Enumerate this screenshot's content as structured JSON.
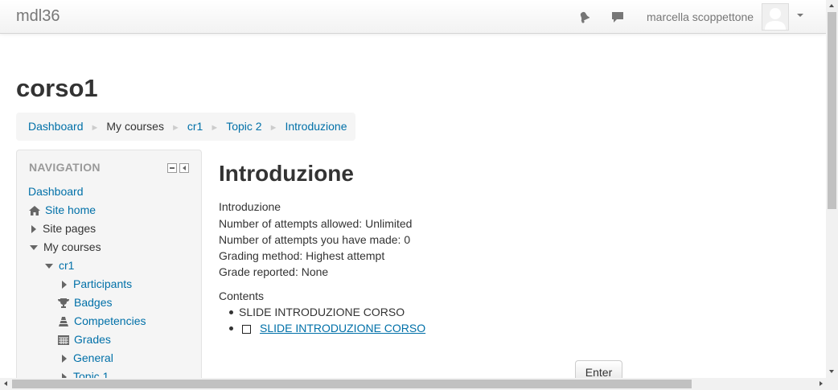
{
  "navbar": {
    "brand": "mdl36",
    "username": "marcella scoppettone"
  },
  "page_title": "corso1",
  "breadcrumb": [
    "Dashboard",
    "My courses",
    "cr1",
    "Topic 2",
    "Introduzione"
  ],
  "navigation": {
    "title": "NAVIGATION",
    "items": [
      "Dashboard",
      "Site home",
      "Site pages",
      "My courses",
      "cr1",
      "Participants",
      "Badges",
      "Competencies",
      "Grades",
      "General",
      "Topic 1"
    ]
  },
  "main": {
    "title": "Introduzione",
    "description": "Introduzione",
    "attempts_allowed": "Number of attempts allowed: Unlimited",
    "attempts_made": "Number of attempts you have made: 0",
    "grading_method": "Grading method: Highest attempt",
    "grade_reported": "Grade reported: None",
    "contents_label": "Contents",
    "contents": [
      "SLIDE INTRODUZIONE CORSO",
      "SLIDE INTRODUZIONE CORSO"
    ],
    "enter_button": "Enter"
  },
  "colors": {
    "link": "#0070a8",
    "text": "#333333",
    "block_bg": "#f5f5f5"
  },
  "icons": [
    "notification-bell-icon",
    "message-icon",
    "avatar-icon",
    "home-icon",
    "trophy-icon",
    "competencies-icon",
    "grades-table-icon"
  ]
}
